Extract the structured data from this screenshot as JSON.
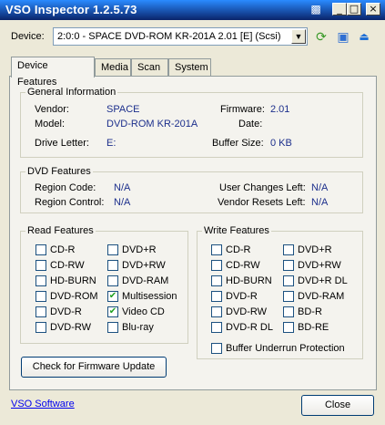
{
  "window": {
    "title": "VSO Inspector 1.2.5.73"
  },
  "device": {
    "label": "Device:",
    "selected": "2:0:0 - SPACE DVD-ROM KR-201A 2.01 [E] (Scsi)"
  },
  "tabs": [
    {
      "label": "Device Features"
    },
    {
      "label": "Media"
    },
    {
      "label": "Scan"
    },
    {
      "label": "System"
    }
  ],
  "general": {
    "title": "General Information",
    "vendor_label": "Vendor:",
    "vendor": "SPACE",
    "model_label": "Model:",
    "model": "DVD-ROM KR-201A",
    "drive_letter_label": "Drive Letter:",
    "drive_letter": "E:",
    "firmware_label": "Firmware:",
    "firmware": "2.01",
    "date_label": "Date:",
    "date": "",
    "buffer_label": "Buffer Size:",
    "buffer": "0 KB"
  },
  "dvd": {
    "title": "DVD Features",
    "region_code_label": "Region Code:",
    "region_code": "N/A",
    "region_control_label": "Region Control:",
    "region_control": "N/A",
    "user_changes_label": "User Changes Left:",
    "user_changes": "N/A",
    "vendor_resets_label": "Vendor Resets Left:",
    "vendor_resets": "N/A"
  },
  "read": {
    "title": "Read Features",
    "items": [
      {
        "label": "CD-R",
        "checked": false
      },
      {
        "label": "DVD+R",
        "checked": false
      },
      {
        "label": "CD-RW",
        "checked": false
      },
      {
        "label": "DVD+RW",
        "checked": false
      },
      {
        "label": "HD-BURN",
        "checked": false
      },
      {
        "label": "DVD-RAM",
        "checked": false
      },
      {
        "label": "DVD-ROM",
        "checked": false
      },
      {
        "label": "Multisession",
        "checked": true
      },
      {
        "label": "DVD-R",
        "checked": false
      },
      {
        "label": "Video CD",
        "checked": true
      },
      {
        "label": "DVD-RW",
        "checked": false
      },
      {
        "label": "Blu-ray",
        "checked": false
      }
    ]
  },
  "write": {
    "title": "Write Features",
    "items": [
      {
        "label": "CD-R",
        "checked": false
      },
      {
        "label": "DVD+R",
        "checked": false
      },
      {
        "label": "CD-RW",
        "checked": false
      },
      {
        "label": "DVD+RW",
        "checked": false
      },
      {
        "label": "HD-BURN",
        "checked": false
      },
      {
        "label": "DVD+R DL",
        "checked": false
      },
      {
        "label": "DVD-R",
        "checked": false
      },
      {
        "label": "DVD-RAM",
        "checked": false
      },
      {
        "label": "DVD-RW",
        "checked": false
      },
      {
        "label": "BD-R",
        "checked": false
      },
      {
        "label": "DVD-R DL",
        "checked": false
      },
      {
        "label": "BD-RE",
        "checked": false
      }
    ],
    "buffer_underrun_label": "Buffer Underrun Protection",
    "buffer_underrun_checked": false
  },
  "buttons": {
    "firmware_update": "Check for Firmware Update",
    "close": "Close"
  },
  "footer": {
    "link": "VSO Software"
  },
  "colors": {
    "value_text": "#1c2f8c",
    "titlebar": "#0a246a",
    "check": "#21a121"
  }
}
